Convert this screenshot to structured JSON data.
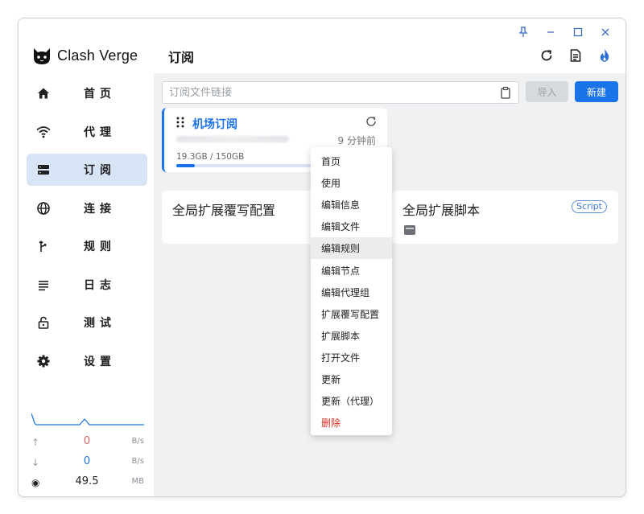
{
  "app": {
    "name": "Clash Verge"
  },
  "page": {
    "title": "订阅"
  },
  "window_controls": [
    "pin-icon",
    "minimize-icon",
    "maximize-icon",
    "close-icon"
  ],
  "toolbar_icons": [
    "refresh-icon",
    "log-icon",
    "fire-icon"
  ],
  "sidebar": {
    "items": [
      {
        "label": "首页",
        "icon": "home-icon",
        "active": false
      },
      {
        "label": "代理",
        "icon": "wifi-icon",
        "active": false
      },
      {
        "label": "订阅",
        "icon": "dns-icon",
        "active": true
      },
      {
        "label": "连接",
        "icon": "globe-icon",
        "active": false
      },
      {
        "label": "规则",
        "icon": "fork-icon",
        "active": false
      },
      {
        "label": "日志",
        "icon": "list-icon",
        "active": false
      },
      {
        "label": "测试",
        "icon": "lock-icon",
        "active": false
      },
      {
        "label": "设置",
        "icon": "gear-icon",
        "active": false
      }
    ]
  },
  "traffic": {
    "upload": {
      "value": "0",
      "unit": "B/s",
      "color": "#e06464"
    },
    "download": {
      "value": "0",
      "unit": "B/s",
      "color": "#1a73e8"
    },
    "memory": {
      "value": "49.5",
      "unit": "MB"
    }
  },
  "search": {
    "placeholder": "订阅文件链接"
  },
  "buttons": {
    "import": "导入",
    "new": "新建"
  },
  "profile": {
    "name": "机场订阅",
    "updated": "9 分钟前",
    "usage": "19.3GB / 150GB",
    "usage_fraction": 0.129
  },
  "global_cards": {
    "merge": {
      "title": "全局扩展覆写配置"
    },
    "script": {
      "title": "全局扩展脚本",
      "badge": "Script"
    }
  },
  "context_menu": {
    "items": [
      "首页",
      "使用",
      "编辑信息",
      "编辑文件",
      "编辑规则",
      "编辑节点",
      "编辑代理组",
      "扩展覆写配置",
      "扩展脚本",
      "打开文件",
      "更新",
      "更新（代理）",
      "删除"
    ],
    "hover_item": "编辑规则",
    "danger_item": "删除"
  },
  "colors": {
    "accent": "#1a73e8",
    "active_nav": "#d7e5f6",
    "danger": "#d93025"
  }
}
